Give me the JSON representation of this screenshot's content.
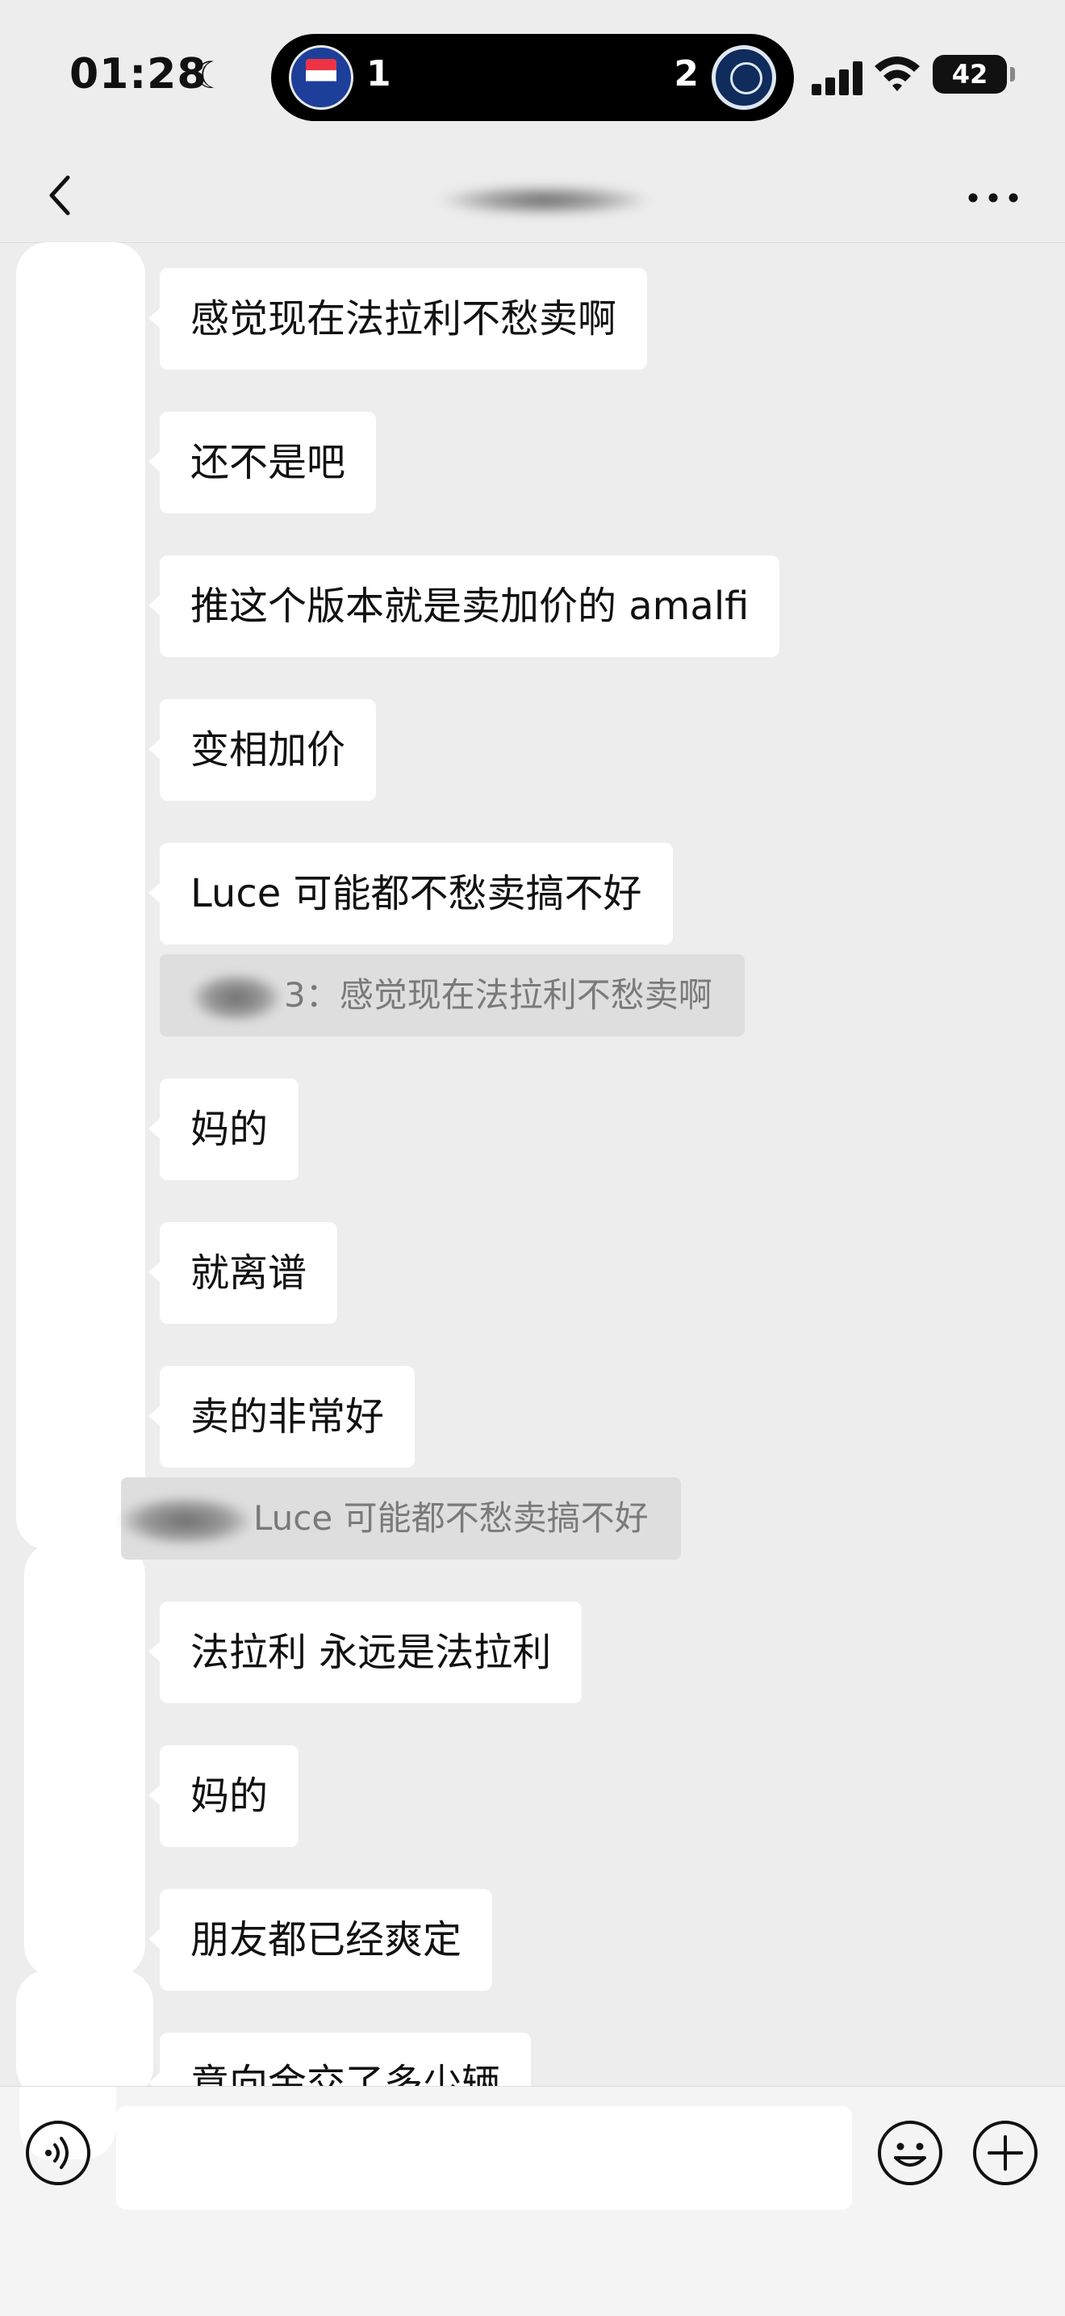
{
  "status_bar": {
    "time": "01:28",
    "moon_icon": "moon-icon",
    "live_activity": {
      "home_score": "1",
      "away_score": "2"
    },
    "battery": "42"
  },
  "nav": {
    "back_icon": "chevron-left-icon",
    "more_icon": "ellipsis-icon"
  },
  "messages": [
    {
      "text": "感觉现在法拉利不愁卖啊"
    },
    {
      "text": "还不是吧"
    },
    {
      "text": "推这个版本就是卖加价的 amalfi"
    },
    {
      "text": "变相加价"
    },
    {
      "text": "Luce 可能都不愁卖搞不好"
    },
    {
      "quote_suffix": "3：感觉现在法拉利不愁卖啊"
    },
    {
      "text": "妈的"
    },
    {
      "text": "就离谱"
    },
    {
      "text": "卖的非常好"
    },
    {
      "quote_text": "Luce 可能都不愁卖搞不好"
    },
    {
      "text": "法拉利 永远是法拉利"
    },
    {
      "text": "妈的"
    },
    {
      "text": "朋友都已经爽定"
    },
    {
      "text": "意向金交了多少辆"
    }
  ],
  "input_bar": {
    "voice_icon": "voice-icon",
    "emoji_icon": "smiley-icon",
    "plus_icon": "plus-icon",
    "placeholder": ""
  }
}
